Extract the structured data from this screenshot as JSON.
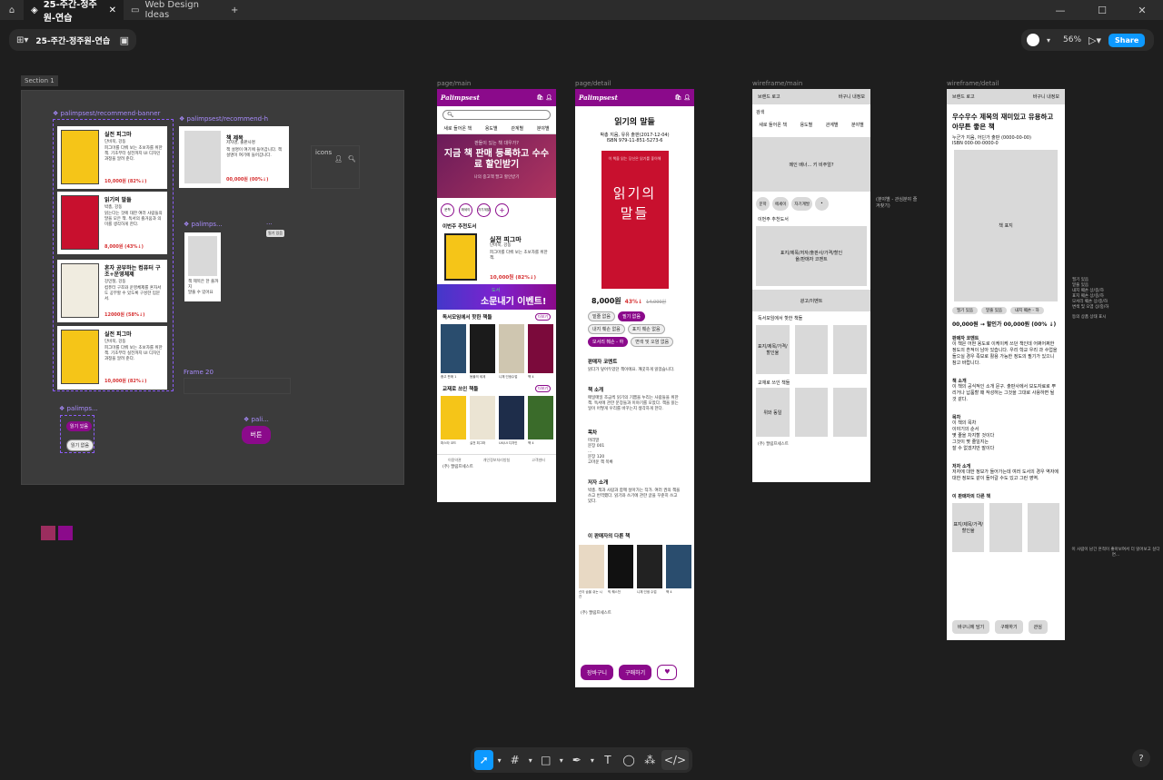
{
  "tabs": [
    {
      "label": "25-주간-정주원-연습"
    },
    {
      "label": "Web Design Ideas"
    }
  ],
  "title": "25-주간-정주원-연습",
  "zoom": "56%",
  "share": "Share",
  "section": "Section 1",
  "layers": {
    "banner": "palimpsest/recommend-banner",
    "recH": "palimpsest/recommend-h",
    "icons": "icons",
    "palimp": "palimps...",
    "palimp2": "palimps...",
    "pali": "pali...",
    "frame20": "Frame 20",
    "dots": "..."
  },
  "buttons": {
    "read_on": "읽기 있음",
    "read_off": "읽기 없음",
    "btn": "버튼"
  },
  "cards": [
    {
      "title": "실전 피그마",
      "author": "단비북, 강동",
      "desc": "피그마를 다뤄 보는 초보자를 위한 책. 기초부터 실전까지 UI 디자인 과정을 알려 준다.",
      "price": "10,000원 (82%↓)"
    },
    {
      "title": "읽기의 말들",
      "author": "박총, 강동",
      "desc": "읽는다는 것에 대한 여러 사람들의 말을 모은 책. 독서의 즐거움과 의미를 생각하게 한다.",
      "price": "8,000원 (43%↓)"
    },
    {
      "title": "혼자 공부하는 컴퓨터 구조+운영체제",
      "author": "강민철, 강동",
      "desc": "컴퓨터 구조와 운영체제를 혼자서도 공부할 수 있도록 구성한 입문서.",
      "price": "12000원 (58%↓)"
    },
    {
      "title": "실전 피그마",
      "author": "단비북, 강동",
      "desc": "피그마를 다뤄 보는 초보자를 위한 책. 기초부터 실전까지 UI 디자인 과정을 알려 준다.",
      "price": "10,000원 (82%↓)"
    }
  ],
  "recH": {
    "title": "책 제목",
    "author": "저자명, 출판사명",
    "desc": "책 설명이 여기에 들어갑니다. 책 설명이 여기에 들어갑니다.",
    "price": "00,000원 (00%↓)"
  },
  "mini": {
    "title": "책 제목은 한 줄까지",
    "sub": "말줄 수 있어요"
  },
  "main": {
    "label": "page/main",
    "brand": "Palimpsest",
    "nav": [
      "새로 들어온 책",
      "용도별",
      "관계별",
      "분야별"
    ],
    "banner_small": "판들이 있는 책 대우가?",
    "banner_big": "지금 책 판매 등록하고 수수료 할인받기",
    "banner_note": "나의 중고책 팔고 할인받기",
    "chips": [
      "문학",
      "에세이",
      "자기계발"
    ],
    "week": "이번주 추천도서",
    "week_title": "실전 피그마",
    "week_author": "단비북, 강동",
    "week_desc": "피그마를 다뤄 보는 초보자를 위한 책.",
    "week_price": "10,000원 (82%↓)",
    "event_top": "도서",
    "event": "소문내기 이벤트!",
    "club": "독서모임에서 핫한 책들",
    "more": "더보기",
    "club_books": [
      "중고 판매 1",
      "동물의 세계",
      "니체 인생수업",
      "책 4"
    ],
    "text": "교재로 쓰인 책들",
    "text_books": [
      "파스타 코드",
      "실전 피그마",
      "UX/UI 디자인",
      "책 4"
    ],
    "footer": [
      "이용약관",
      "개인정보처리방침",
      "고객센터"
    ],
    "company": "(주) 팔림프세스트"
  },
  "detail": {
    "label": "page/detail",
    "title": "읽기의 말들",
    "meta": "박총 지음, 유유 출판(2017-12-04)",
    "isbn": "ISBN 979-11-851-5273-6",
    "cover": "읽기의 말들",
    "cover_top": "이 책을 읽는 당신은 읽기를 좋아해",
    "price": "8,000원",
    "discount": "43%↓",
    "orig": "14,000원",
    "tags": [
      "밑줄 없음",
      "필기 없음",
      "내지 훼손 없음",
      "표지 훼손 없음",
      "모서리 훼손 - 하",
      "변색 및 오염 없음"
    ],
    "seller_h": "판매자 코멘트",
    "seller": "읽다가 덮어두었던 책이에요. 깨끗하게 읽었습니다.",
    "intro_h": "책 소개",
    "intro": "매일매일 조금씩 읽기의 기쁨을 누리는 사람들을 위한 책. 독서에 관한 문장들과 이야기를 모았다. 책을 읽는 일이 어떻게 우리를 바꾸는지 생각하게 한다.",
    "toc_h": "목차",
    "toc": [
      "머리말",
      "문장 001",
      "...",
      "문장 120",
      "고마운 책 목록"
    ],
    "author_h": "저자 소개",
    "author": "박총. 책과 사람과 함께 살아가는 작가. 여러 권의 책을 쓰고 번역했다. 읽기와 쓰기에 관한 글을 꾸준히 쓰고 있다.",
    "other": "이 판매자의 다른 책",
    "other_books": [
      "신이 숨을 쉬는 시간",
      "빅 퀘스천",
      "니체 인생 수업",
      "책 4"
    ],
    "cart": "장바구니",
    "buy": "구매하기",
    "company": "(주) 팔림프세스트"
  },
  "wmain": {
    "label": "wireframe/main",
    "logo": "브랜드 로고",
    "cart": "바구니 내정보",
    "search": "검색",
    "nav": [
      "새로 들어온 책",
      "용도별",
      "관계별",
      "분야별"
    ],
    "banner": "메인 배너... 키 비주얼?",
    "chips": [
      "문학",
      "에세이",
      "자기계발",
      "•"
    ],
    "note": "(분야별 - 관심분야 즐겨찾기)",
    "week": "이번주 추천도서",
    "week_box": "표지/제목/저자/출판사/가격/할인율/판매자 코멘트",
    "ad": "광고/이벤트",
    "club": "독서모임에서 핫한 책들",
    "cover": "표지/제목/가격/할인율",
    "text": "교재로 쓰인 책들",
    "text_box": "위와 동일",
    "company": "(주) 팔림프세스트"
  },
  "wdetail": {
    "label": "wireframe/detail",
    "logo": "브랜드 로고",
    "cart": "바구니 내정보",
    "title": "우수우수 제목의 재미있고 유용하고 아무튼 좋은 책",
    "meta": "누군가 지음, 어딘가 출판 (0000-00-00)",
    "isbn": "ISBN 000-00-0000-0",
    "cover": "책 표지",
    "tags": [
      "필기 있음",
      "밑줄 있음",
      "내지 훼손 - 하"
    ],
    "price": "00,000원 → 할인가 00,000원 (00% ↓)",
    "seller_h": "판매자 코멘트",
    "seller": "이 책은 어떤 용도로 이케이케 쓰던 책인데 어쩌어쩌한 정도의 흔적이 남아 있습니다. 우리 학교 우리 과 수업을 들으실 경우 족보로 활용 가능한 정도의 필기가 있으니 참고 바랍니다.",
    "intro_h": "책 소개",
    "intro": "이 책의 공식적인 소개 문구. 출판사에서 보도자료로 뿌리거나 납품할 때 작성하는 그것을 그대로 사용하면 될 것 같다.",
    "toc_h": "목차",
    "toc": [
      "이 책의 목차",
      "이야기의 순서",
      "몇 줄을 차지할 것이다",
      "그것이 몇 줄일지는",
      "잘 수 없겠지만 말이다"
    ],
    "author_h": "저자 소개",
    "author": "저자에 대한 정보가 들어가는데 여러 도서의 경우 역자에 대한 정보도 같이 들어갈 수도 있고 그런 영역.",
    "other": "이 판매자의 다른 책",
    "other_box": "표지/제목/가격/할인율",
    "buttons": [
      "바구니에 담기",
      "구매하기",
      "관심"
    ],
    "side1": "필기 있음\n밑줄 있음\n내지 훼손 상/중/하\n표지 훼손 상/중/하\n모서리 훼손 상/중/하\n변색 및 오염 상/중/하",
    "side2": "등의 상품 상태 표시",
    "side3": "이 사람이 남긴 흔적이 좋아보여서 더 읽어보고 싶다면..."
  },
  "colors": {
    "brand": "#8b0a8b",
    "accent": "#0d99ff",
    "swatch1": "#9b2d5e",
    "swatch2": "#8b0a8b"
  }
}
